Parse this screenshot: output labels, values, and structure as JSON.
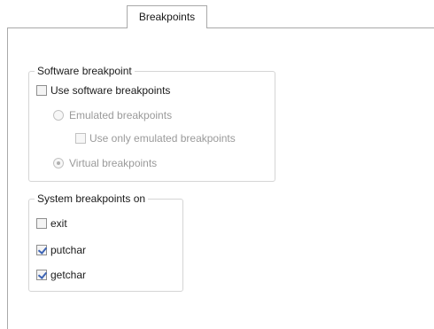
{
  "tab": {
    "label": "Breakpoints"
  },
  "software_group": {
    "legend": "Software breakpoint",
    "use_software": {
      "label": "Use software breakpoints",
      "checked": false
    },
    "emulated": {
      "label": "Emulated breakpoints",
      "selected": false
    },
    "use_only_emulated": {
      "label": "Use only emulated breakpoints",
      "checked": false
    },
    "virtual": {
      "label": "Virtual breakpoints",
      "selected": true
    }
  },
  "system_group": {
    "legend": "System breakpoints on",
    "exit": {
      "label": "exit",
      "checked": false
    },
    "putchar": {
      "label": "putchar",
      "checked": true
    },
    "getchar": {
      "label": "getchar",
      "checked": true
    }
  }
}
